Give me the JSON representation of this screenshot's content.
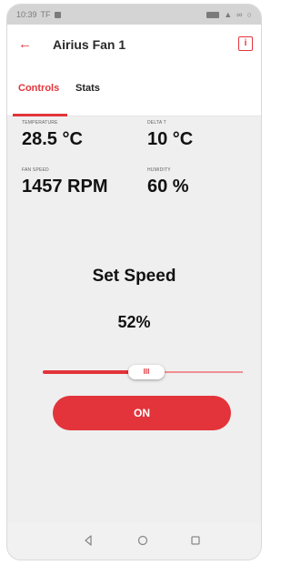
{
  "status_bar": {
    "time": "10:39",
    "carrier": "TF",
    "right_icons": [
      "battery-icon",
      "signal-icon",
      "wifi-icon",
      "sync-icon"
    ]
  },
  "app_bar": {
    "title": "Airius Fan 1",
    "back_icon": "arrow-left-icon",
    "info_label": "i"
  },
  "tabs": [
    {
      "label": "Controls",
      "active": true
    },
    {
      "label": "Stats",
      "active": false
    }
  ],
  "metrics": {
    "temperature": {
      "label": "TEMPERATURE",
      "value": "28.5 °C"
    },
    "delta_t": {
      "label": "DELTA T",
      "value": "10 °C"
    },
    "fan_speed": {
      "label": "FAN SPEED",
      "value": "1457 RPM"
    },
    "humidity": {
      "label": "HUMIDITY",
      "value": "60 %"
    }
  },
  "speed_control": {
    "title": "Set Speed",
    "value_label": "52%",
    "value": 0.52,
    "thumb_grip": "III"
  },
  "power_button": {
    "label": "ON"
  },
  "colors": {
    "accent": "#e3343b",
    "track_light": "#f08f93",
    "background": "#efefef"
  },
  "nav_bar": {
    "icons": [
      "triangle-back-icon",
      "circle-home-icon",
      "square-recents-icon"
    ]
  }
}
